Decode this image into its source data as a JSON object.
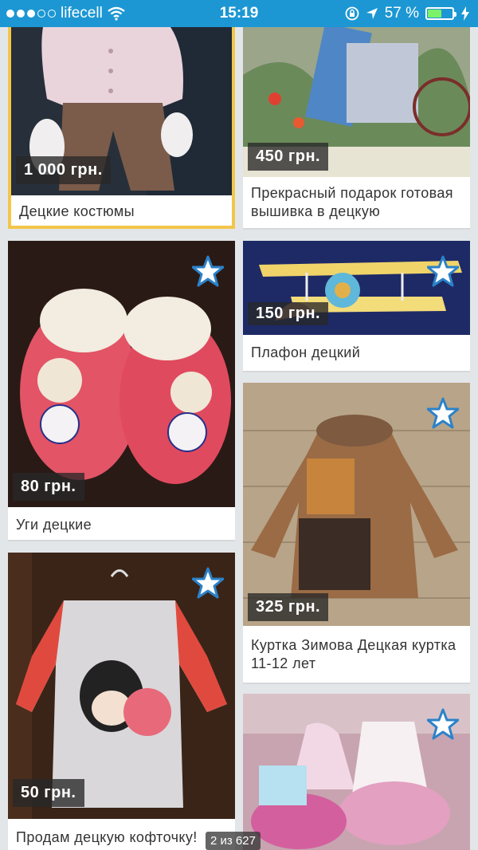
{
  "status": {
    "carrier": "lifecell",
    "time": "15:19",
    "battery": "57 %",
    "battery_level": 0.57
  },
  "listings": [
    {
      "price": "1 000 грн.",
      "title": "Децкие костюмы",
      "favorite_icon": "star-icon"
    },
    {
      "price": "450 грн.",
      "title": "Прекрасный подарок готовая вышивка в децкую",
      "favorite_icon": "star-icon"
    },
    {
      "price": "80 грн.",
      "title": "Уги децкие",
      "favorite_icon": "star-icon"
    },
    {
      "price": "150 грн.",
      "title": "Плафон децкий",
      "favorite_icon": "star-icon"
    },
    {
      "price": "325 грн.",
      "title": "Куртка Зимова Децкая куртка 11-12 лет",
      "favorite_icon": "star-icon"
    },
    {
      "price": "50 грн.",
      "title": "Продам децкую кофточку!",
      "favorite_icon": "star-icon"
    },
    {
      "price": "",
      "title": "",
      "favorite_icon": "star-icon"
    }
  ],
  "pager": "2 из 627",
  "colors": {
    "statusbar": "#1c97d3",
    "selected_border": "#f2c64a",
    "star_fill": "#ffffff",
    "star_outline": "#2b82c9"
  }
}
